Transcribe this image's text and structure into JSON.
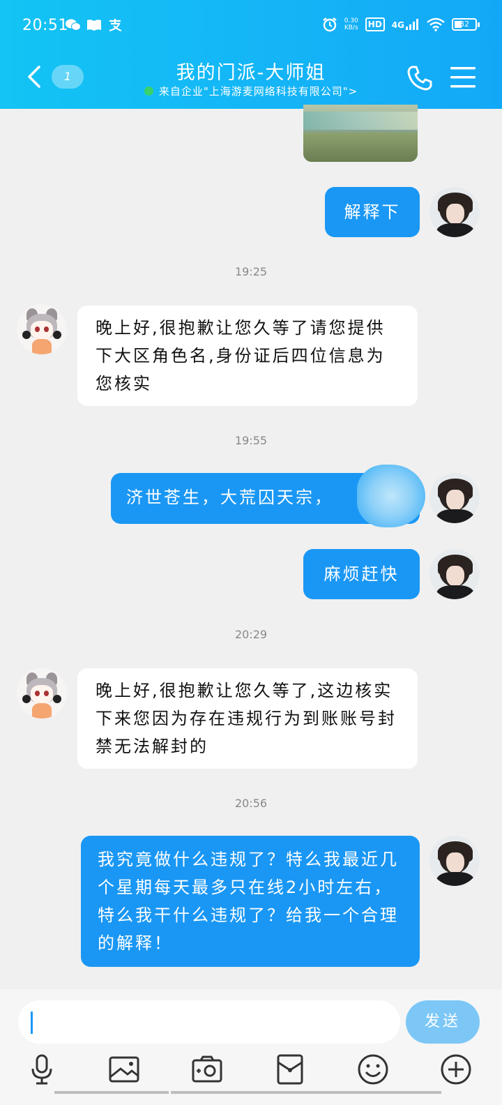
{
  "status_bar": {
    "time": "20:51",
    "net_speed_value": "0.30",
    "net_speed_unit": "KB/s",
    "hd": "HD",
    "network": "4G",
    "battery": "32"
  },
  "header": {
    "unread_count": "1",
    "title": "我的门派-大师姐",
    "subtitle": "来自企业\"上海游麦网络科技有限公司\">"
  },
  "messages": [
    {
      "text": "解释下"
    },
    {
      "time": "19:25"
    },
    {
      "text": "晚上好,很抱歉让您久等了请您提供下大区角色名,身份证后四位信息为您核实"
    },
    {
      "time": "19:55"
    },
    {
      "text": "济世苍生，大荒囚天宗，"
    },
    {
      "text": "麻烦赶快"
    },
    {
      "time": "20:29"
    },
    {
      "text": "晚上好,很抱歉让您久等了,这边核实下来您因为存在违规行为到账账号封禁无法解封的"
    },
    {
      "time": "20:56"
    },
    {
      "text": "我究竟做什么违规了？特么我最近几个星期每天最多只在线2小时左右，特么我干什么违规了？给我一个合理的解释！"
    }
  ],
  "input": {
    "value": "",
    "send_label": "发送"
  },
  "toolbar": [
    "mic-icon",
    "image-icon",
    "camera-icon",
    "red-packet-icon",
    "emoji-icon",
    "plus-icon"
  ],
  "colors": {
    "header": "#14b6f6",
    "sent_bubble": "#1a97f4",
    "received_bubble": "#ffffff",
    "send_button": "#7cc7f6",
    "background": "#f0f0f0"
  }
}
